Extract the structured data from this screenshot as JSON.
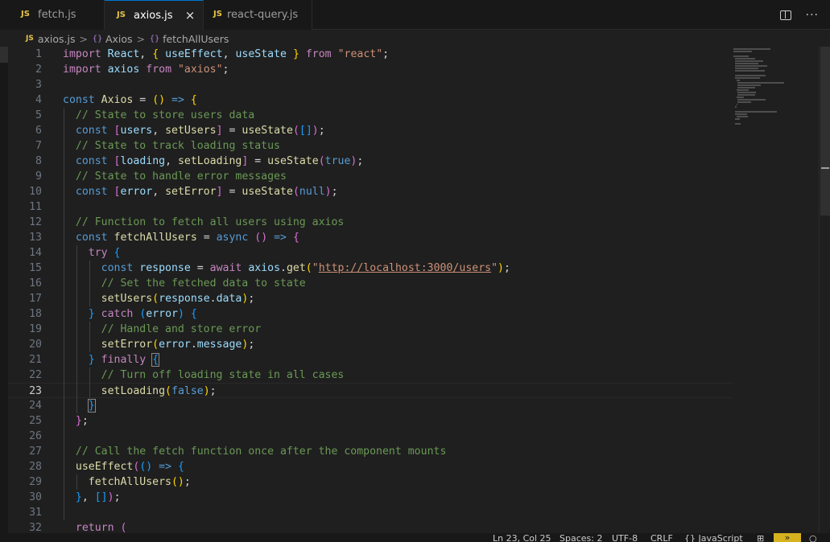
{
  "tabs": [
    {
      "badge": "JS",
      "label": "fetch.js"
    },
    {
      "badge": "JS",
      "label": "axios.js",
      "close": "×"
    },
    {
      "badge": "JS",
      "label": "react-query.js"
    }
  ],
  "breadcrumb": {
    "file_badge": "JS",
    "file": "axios.js",
    "sep": ">",
    "symbol_icon": "{}",
    "symbol1": "Axios",
    "symbol2": "fetchAllUsers"
  },
  "editor": {
    "current_line": 23,
    "lines": [
      [
        [
          "k",
          "import"
        ],
        [
          "p",
          " "
        ],
        [
          "v",
          "React"
        ],
        [
          "p",
          ", "
        ],
        [
          "b1",
          "{"
        ],
        [
          "p",
          " "
        ],
        [
          "v",
          "useEffect"
        ],
        [
          "p",
          ", "
        ],
        [
          "v",
          "useState"
        ],
        [
          "p",
          " "
        ],
        [
          "b1",
          "}"
        ],
        [
          "p",
          " "
        ],
        [
          "k",
          "from"
        ],
        [
          "p",
          " "
        ],
        [
          "s",
          "\"react\""
        ],
        [
          "p",
          ";"
        ]
      ],
      [
        [
          "k",
          "import"
        ],
        [
          "p",
          " "
        ],
        [
          "v",
          "axios"
        ],
        [
          "p",
          " "
        ],
        [
          "k",
          "from"
        ],
        [
          "p",
          " "
        ],
        [
          "s",
          "\"axios\""
        ],
        [
          "p",
          ";"
        ]
      ],
      [],
      [
        [
          "kb",
          "const"
        ],
        [
          "p",
          " "
        ],
        [
          "f",
          "Axios"
        ],
        [
          "p",
          " = "
        ],
        [
          "b1",
          "()"
        ],
        [
          "p",
          " "
        ],
        [
          "kb",
          "=>"
        ],
        [
          "p",
          " "
        ],
        [
          "b1",
          "{"
        ]
      ],
      [
        [
          "p",
          "  "
        ],
        [
          "c",
          "// State to store users data"
        ]
      ],
      [
        [
          "p",
          "  "
        ],
        [
          "kb",
          "const"
        ],
        [
          "p",
          " "
        ],
        [
          "b2",
          "["
        ],
        [
          "v",
          "users"
        ],
        [
          "p",
          ", "
        ],
        [
          "f",
          "setUsers"
        ],
        [
          "b2",
          "]"
        ],
        [
          "p",
          " = "
        ],
        [
          "f",
          "useState"
        ],
        [
          "b2",
          "("
        ],
        [
          "b3",
          "[]"
        ],
        [
          "b2",
          ")"
        ],
        [
          "p",
          ";"
        ]
      ],
      [
        [
          "p",
          "  "
        ],
        [
          "c",
          "// State to track loading status"
        ]
      ],
      [
        [
          "p",
          "  "
        ],
        [
          "kb",
          "const"
        ],
        [
          "p",
          " "
        ],
        [
          "b2",
          "["
        ],
        [
          "v",
          "loading"
        ],
        [
          "p",
          ", "
        ],
        [
          "f",
          "setLoading"
        ],
        [
          "b2",
          "]"
        ],
        [
          "p",
          " = "
        ],
        [
          "f",
          "useState"
        ],
        [
          "b2",
          "("
        ],
        [
          "kb",
          "true"
        ],
        [
          "b2",
          ")"
        ],
        [
          "p",
          ";"
        ]
      ],
      [
        [
          "p",
          "  "
        ],
        [
          "c",
          "// State to handle error messages"
        ]
      ],
      [
        [
          "p",
          "  "
        ],
        [
          "kb",
          "const"
        ],
        [
          "p",
          " "
        ],
        [
          "b2",
          "["
        ],
        [
          "v",
          "error"
        ],
        [
          "p",
          ", "
        ],
        [
          "f",
          "setError"
        ],
        [
          "b2",
          "]"
        ],
        [
          "p",
          " = "
        ],
        [
          "f",
          "useState"
        ],
        [
          "b2",
          "("
        ],
        [
          "kb",
          "null"
        ],
        [
          "b2",
          ")"
        ],
        [
          "p",
          ";"
        ]
      ],
      [],
      [
        [
          "p",
          "  "
        ],
        [
          "c",
          "// Function to fetch all users using axios"
        ]
      ],
      [
        [
          "p",
          "  "
        ],
        [
          "kb",
          "const"
        ],
        [
          "p",
          " "
        ],
        [
          "f",
          "fetchAllUsers"
        ],
        [
          "p",
          " = "
        ],
        [
          "kb",
          "async"
        ],
        [
          "p",
          " "
        ],
        [
          "b2",
          "()"
        ],
        [
          "p",
          " "
        ],
        [
          "kb",
          "=>"
        ],
        [
          "p",
          " "
        ],
        [
          "b2",
          "{"
        ]
      ],
      [
        [
          "p",
          "    "
        ],
        [
          "k",
          "try"
        ],
        [
          "p",
          " "
        ],
        [
          "b3",
          "{"
        ]
      ],
      [
        [
          "p",
          "      "
        ],
        [
          "kb",
          "const"
        ],
        [
          "p",
          " "
        ],
        [
          "v",
          "response"
        ],
        [
          "p",
          " = "
        ],
        [
          "k",
          "await"
        ],
        [
          "p",
          " "
        ],
        [
          "v",
          "axios"
        ],
        [
          "p",
          "."
        ],
        [
          "f",
          "get"
        ],
        [
          "b1",
          "("
        ],
        [
          "s",
          "\""
        ],
        [
          "su",
          "http://localhost:3000/users"
        ],
        [
          "s",
          "\""
        ],
        [
          "b1",
          ")"
        ],
        [
          "p",
          ";"
        ]
      ],
      [
        [
          "p",
          "      "
        ],
        [
          "c",
          "// Set the fetched data to state"
        ]
      ],
      [
        [
          "p",
          "      "
        ],
        [
          "f",
          "setUsers"
        ],
        [
          "b1",
          "("
        ],
        [
          "v",
          "response"
        ],
        [
          "p",
          "."
        ],
        [
          "v",
          "data"
        ],
        [
          "b1",
          ")"
        ],
        [
          "p",
          ";"
        ]
      ],
      [
        [
          "p",
          "    "
        ],
        [
          "b3",
          "}"
        ],
        [
          "p",
          " "
        ],
        [
          "k",
          "catch"
        ],
        [
          "p",
          " "
        ],
        [
          "b3",
          "("
        ],
        [
          "v",
          "error"
        ],
        [
          "b3",
          ")"
        ],
        [
          "p",
          " "
        ],
        [
          "b3",
          "{"
        ]
      ],
      [
        [
          "p",
          "      "
        ],
        [
          "c",
          "// Handle and store error"
        ]
      ],
      [
        [
          "p",
          "      "
        ],
        [
          "f",
          "setError"
        ],
        [
          "b1",
          "("
        ],
        [
          "v",
          "error"
        ],
        [
          "p",
          "."
        ],
        [
          "v",
          "message"
        ],
        [
          "b1",
          ")"
        ],
        [
          "p",
          ";"
        ]
      ],
      [
        [
          "p",
          "    "
        ],
        [
          "b3",
          "}"
        ],
        [
          "p",
          " "
        ],
        [
          "k",
          "finally"
        ],
        [
          "p",
          " "
        ],
        [
          "bm",
          "{"
        ]
      ],
      [
        [
          "p",
          "      "
        ],
        [
          "c",
          "// Turn off loading state in all cases"
        ]
      ],
      [
        [
          "p",
          "      "
        ],
        [
          "f",
          "setLoading"
        ],
        [
          "b1",
          "("
        ],
        [
          "kb",
          "false"
        ],
        [
          "b1",
          ")"
        ],
        [
          "p",
          ";"
        ]
      ],
      [
        [
          "p",
          "    "
        ],
        [
          "bm",
          "}"
        ]
      ],
      [
        [
          "p",
          "  "
        ],
        [
          "b2",
          "}"
        ],
        [
          "p",
          ";"
        ]
      ],
      [],
      [
        [
          "p",
          "  "
        ],
        [
          "c",
          "// Call the fetch function once after the component mounts"
        ]
      ],
      [
        [
          "p",
          "  "
        ],
        [
          "f",
          "useEffect"
        ],
        [
          "b2",
          "("
        ],
        [
          "b3",
          "()"
        ],
        [
          "p",
          " "
        ],
        [
          "kb",
          "=>"
        ],
        [
          "p",
          " "
        ],
        [
          "b3",
          "{"
        ]
      ],
      [
        [
          "p",
          "    "
        ],
        [
          "f",
          "fetchAllUsers"
        ],
        [
          "b1",
          "()"
        ],
        [
          "p",
          ";"
        ]
      ],
      [
        [
          "p",
          "  "
        ],
        [
          "b3",
          "}"
        ],
        [
          "p",
          ", "
        ],
        [
          "b3",
          "[]"
        ],
        [
          "b2",
          ")"
        ],
        [
          "p",
          ";"
        ]
      ],
      [],
      [
        [
          "p",
          "  "
        ],
        [
          "k",
          "return"
        ],
        [
          "p",
          " "
        ],
        [
          "b2",
          "("
        ]
      ]
    ]
  },
  "statusbar": {
    "position": "Ln 23, Col 25",
    "spaces": "Spaces: 2",
    "encoding": "UTF-8",
    "eol": "CRLF",
    "language": "{} JavaScript",
    "badge_icon": "copilot-icon"
  }
}
